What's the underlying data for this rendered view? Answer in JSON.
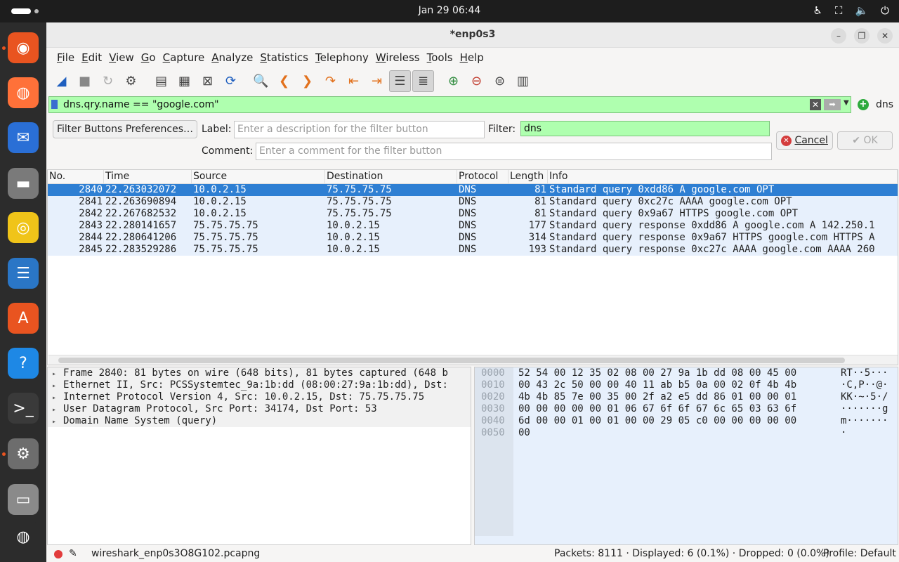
{
  "system": {
    "clock": "Jan 29  06:44",
    "tray_icons": [
      "accessibility-icon",
      "network-icon",
      "volume-icon",
      "power-icon"
    ]
  },
  "dock": {
    "apps": [
      {
        "name": "ubuntu-installer",
        "glyph": "◉",
        "color": "#e95420"
      },
      {
        "name": "firefox",
        "glyph": "◍",
        "color": "#ff7139"
      },
      {
        "name": "thunderbird",
        "glyph": "✉",
        "color": "#2a6fd6"
      },
      {
        "name": "files",
        "glyph": "▬",
        "color": "#7a7a7a"
      },
      {
        "name": "rhythmbox",
        "glyph": "◎",
        "color": "#f0c419"
      },
      {
        "name": "libreoffice-writer",
        "glyph": "☰",
        "color": "#2a76c6"
      },
      {
        "name": "app-center",
        "glyph": "A",
        "color": "#e95420"
      },
      {
        "name": "help",
        "glyph": "?",
        "color": "#1e88e5"
      },
      {
        "name": "terminal",
        "glyph": ">_",
        "color": "#3a3a3a"
      },
      {
        "name": "settings",
        "glyph": "⚙",
        "color": "#6d6d6d"
      },
      {
        "name": "disk",
        "glyph": "▭",
        "color": "#8a8a8a"
      },
      {
        "name": "show-apps",
        "glyph": "◍",
        "color": "#2c2c2c"
      }
    ]
  },
  "window": {
    "title": "*enp0s3",
    "menu": [
      "File",
      "Edit",
      "View",
      "Go",
      "Capture",
      "Analyze",
      "Statistics",
      "Telephony",
      "Wireless",
      "Tools",
      "Help"
    ]
  },
  "toolbar": {
    "buttons": [
      "start-capture",
      "stop-capture",
      "restart-capture",
      "capture-options",
      "open-file",
      "save-file",
      "close-file",
      "reload-file",
      "find-packet",
      "go-back",
      "go-forward",
      "go-to-packet",
      "first-packet",
      "last-packet",
      "auto-scroll",
      "colorize",
      "zoom-in",
      "zoom-out",
      "normal-size",
      "resize-columns"
    ]
  },
  "filter": {
    "value": "dns.qry.name == \"google.com\"",
    "button_label": "dns"
  },
  "prefs": {
    "prefs_button": "Filter Buttons Preferences…",
    "label_label": "Label:",
    "label_placeholder": "Enter a description for the filter button",
    "filter_label": "Filter:",
    "filter_value": "dns",
    "comment_label": "Comment:",
    "comment_placeholder": "Enter a comment for the filter button",
    "cancel_label": "Cancel",
    "ok_label": "OK"
  },
  "packets": {
    "columns": [
      "No.",
      "Time",
      "Source",
      "Destination",
      "Protocol",
      "Length",
      "Info"
    ],
    "rows": [
      {
        "no": "2840",
        "time": "22.263032072",
        "src": "10.0.2.15",
        "dst": "75.75.75.75",
        "proto": "DNS",
        "len": "81",
        "info": "Standard query 0xdd86 A google.com OPT",
        "selected": true
      },
      {
        "no": "2841",
        "time": "22.263690894",
        "src": "10.0.2.15",
        "dst": "75.75.75.75",
        "proto": "DNS",
        "len": "81",
        "info": "Standard query 0xc27c AAAA google.com OPT",
        "selected": false
      },
      {
        "no": "2842",
        "time": "22.267682532",
        "src": "10.0.2.15",
        "dst": "75.75.75.75",
        "proto": "DNS",
        "len": "81",
        "info": "Standard query 0x9a67 HTTPS google.com OPT",
        "selected": false
      },
      {
        "no": "2843",
        "time": "22.280141657",
        "src": "75.75.75.75",
        "dst": "10.0.2.15",
        "proto": "DNS",
        "len": "177",
        "info": "Standard query response 0xdd86 A google.com A 142.250.1",
        "selected": false
      },
      {
        "no": "2844",
        "time": "22.280641206",
        "src": "75.75.75.75",
        "dst": "10.0.2.15",
        "proto": "DNS",
        "len": "314",
        "info": "Standard query response 0x9a67 HTTPS google.com HTTPS A",
        "selected": false
      },
      {
        "no": "2845",
        "time": "22.283529286",
        "src": "75.75.75.75",
        "dst": "10.0.2.15",
        "proto": "DNS",
        "len": "193",
        "info": "Standard query response 0xc27c AAAA google.com AAAA 260",
        "selected": false
      }
    ]
  },
  "details": [
    "Frame 2840: 81 bytes on wire (648 bits), 81 bytes captured (648 b",
    "Ethernet II, Src: PCSSystemtec_9a:1b:dd (08:00:27:9a:1b:dd), Dst:",
    "Internet Protocol Version 4, Src: 10.0.2.15, Dst: 75.75.75.75",
    "User Datagram Protocol, Src Port: 34174, Dst Port: 53",
    "Domain Name System (query)"
  ],
  "bytes": [
    {
      "off": "0000",
      "hex": "52 54 00 12 35 02 08 00  27 9a 1b dd 08 00 45 00",
      "ascii": "RT··5···"
    },
    {
      "off": "0010",
      "hex": "00 43 2c 50 00 00 40 11  ab b5 0a 00 02 0f 4b 4b",
      "ascii": "·C,P··@·"
    },
    {
      "off": "0020",
      "hex": "4b 4b 85 7e 00 35 00 2f  a2 e5 dd 86 01 00 00 01",
      "ascii": "KK·~·5·/"
    },
    {
      "off": "0030",
      "hex": "00 00 00 00 00 01 06 67  6f 6f 67 6c 65 03 63 6f",
      "ascii": "·······g"
    },
    {
      "off": "0040",
      "hex": "6d 00 00 01 00 01 00 00  29 05 c0 00 00 00 00 00",
      "ascii": "m·······"
    },
    {
      "off": "0050",
      "hex": "00",
      "ascii": "·"
    }
  ],
  "status": {
    "file": "wireshark_enp0s3O8G102.pcapng",
    "counts": "Packets: 8111 · Displayed: 6 (0.1%) · Dropped: 0 (0.0%)",
    "profile": "Profile: Default"
  }
}
